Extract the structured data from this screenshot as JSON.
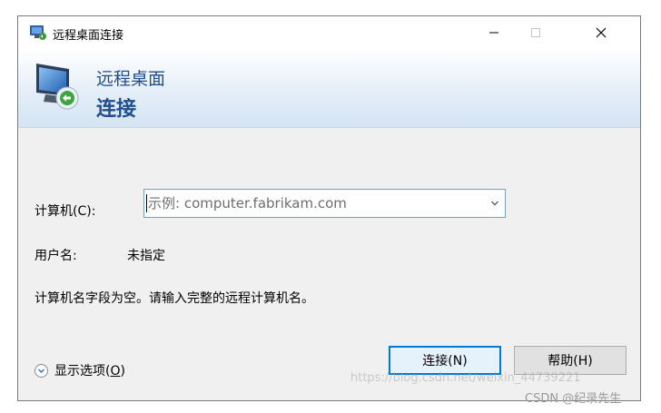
{
  "window": {
    "title": "远程桌面连接",
    "controls": {
      "minimize": "minimize-icon",
      "maximize": "maximize-icon",
      "close": "close-icon"
    }
  },
  "header": {
    "line1": "远程桌面",
    "line2": "连接"
  },
  "form": {
    "computer_label": "计算机(C):",
    "computer_placeholder": "示例: computer.fabrikam.com",
    "computer_value": "",
    "username_label": "用户名:",
    "username_value": "未指定",
    "message": "计算机名字段为空。请输入完整的远程计算机名。"
  },
  "footer": {
    "show_options_prefix": "显示选项(",
    "show_options_key": "O",
    "show_options_suffix": ")",
    "connect_label": "连接(N)",
    "help_label": "帮助(H)"
  },
  "watermarks": {
    "url": "https://blog.csdn.net/weixin_44739221",
    "author": "CSDN @纪录先生"
  },
  "colors": {
    "accent": "#0078d7",
    "header_text": "#1d4f92"
  }
}
